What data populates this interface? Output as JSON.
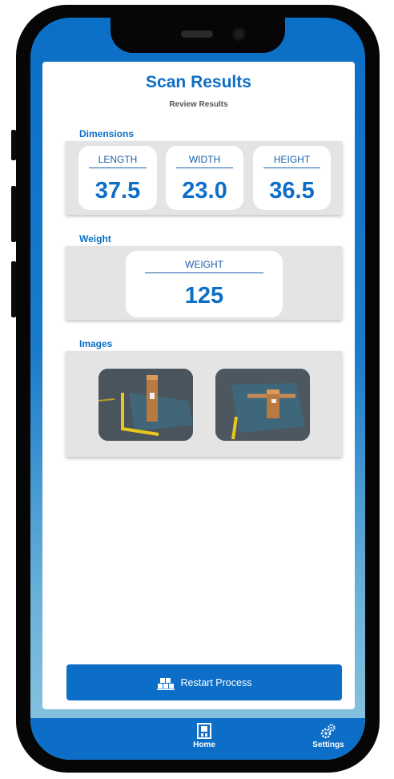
{
  "header": {
    "title": "Scan Results",
    "subtitle": "Review Results"
  },
  "dimensions": {
    "section_label": "Dimensions",
    "items": [
      {
        "label": "LENGTH",
        "value": "37.5"
      },
      {
        "label": "WIDTH",
        "value": "23.0"
      },
      {
        "label": "HEIGHT",
        "value": "36.5"
      }
    ]
  },
  "weight": {
    "section_label": "Weight",
    "label": "WEIGHT",
    "value": "125"
  },
  "images": {
    "section_label": "Images",
    "count": 2
  },
  "actions": {
    "restart_label": "Restart Process",
    "restart_icon": "boxes-icon"
  },
  "tabbar": {
    "items": [
      {
        "label": "Home",
        "icon": "home-icon"
      },
      {
        "label": "Settings",
        "icon": "gears-icon"
      }
    ]
  },
  "colors": {
    "accent": "#0d6ec8",
    "panel": "#e4e4e4",
    "subtitle": "#555555"
  }
}
